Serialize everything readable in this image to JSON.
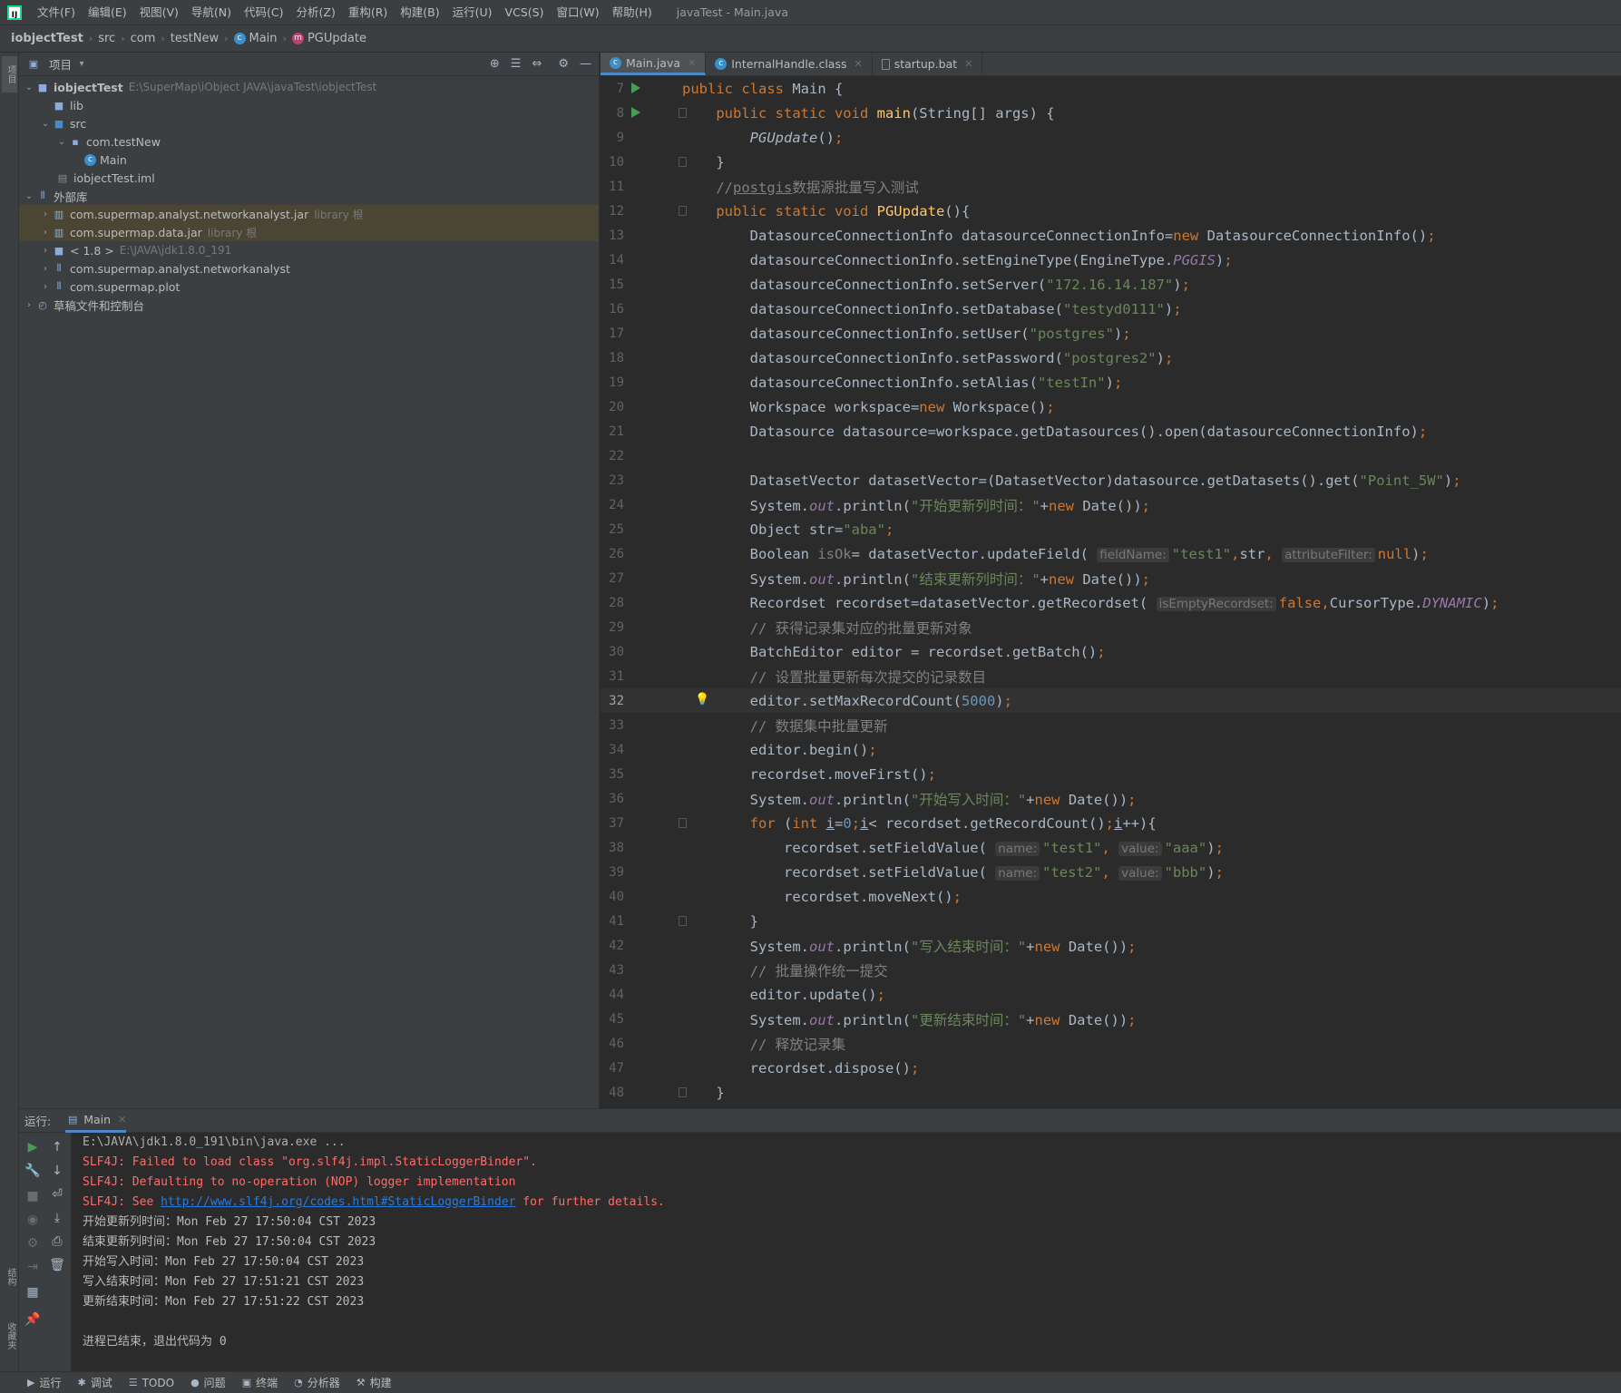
{
  "menu": {
    "items": [
      "文件(F)",
      "编辑(E)",
      "视图(V)",
      "导航(N)",
      "代码(C)",
      "分析(Z)",
      "重构(R)",
      "构建(B)",
      "运行(U)",
      "VCS(S)",
      "窗口(W)",
      "帮助(H)"
    ],
    "window_title": "javaTest - Main.java"
  },
  "breadcrumb": [
    "iobjectTest",
    "src",
    "com",
    "testNew",
    "Main",
    "PGUpdate"
  ],
  "project": {
    "title": "项目",
    "tree": [
      {
        "label": "iobjectTest",
        "hint": "E:\\SuperMap\\iObject JAVA\\javaTest\\iobjectTest"
      },
      {
        "label": "lib",
        "hint": ""
      },
      {
        "label": "src",
        "hint": ""
      },
      {
        "label": "com.testNew",
        "hint": ""
      },
      {
        "label": "Main",
        "hint": ""
      },
      {
        "label": "iobjectTest.iml",
        "hint": ""
      },
      {
        "label": "外部库",
        "hint": ""
      },
      {
        "label": "com.supermap.analyst.networkanalyst.jar",
        "hint": "library 根"
      },
      {
        "label": "com.supermap.data.jar",
        "hint": "library 根"
      },
      {
        "label": "< 1.8 >",
        "hint": "E:\\JAVA\\jdk1.8.0_191"
      },
      {
        "label": "com.supermap.analyst.networkanalyst",
        "hint": ""
      },
      {
        "label": "com.supermap.plot",
        "hint": ""
      },
      {
        "label": "草稿文件和控制台",
        "hint": ""
      }
    ]
  },
  "tabs": [
    "Main.java",
    "InternalHandle.class",
    "startup.bat"
  ],
  "code": {
    "line_numbers": [
      "7",
      "8",
      "9",
      "10",
      "11",
      "12",
      "13",
      "14",
      "15",
      "16",
      "17",
      "18",
      "19",
      "20",
      "21",
      "22",
      "23",
      "24",
      "25",
      "26",
      "27",
      "28",
      "29",
      "30",
      "31",
      "32",
      "33",
      "34",
      "35",
      "36",
      "37",
      "38",
      "39",
      "40",
      "41",
      "42",
      "43",
      "44",
      "45",
      "46",
      "47",
      "48"
    ],
    "current_line": "32",
    "literals": {
      "class_name": "Main",
      "server": "\"172.16.14.187\"",
      "database": "\"testyd0111\"",
      "user": "\"postgres\"",
      "password": "\"postgres2\"",
      "alias": "\"testIn\"",
      "dataset": "\"Point_5W\"",
      "msg_start_update": "\"开始更新列时间：\"",
      "str_value": "\"aba\"",
      "field_test1": "\"test1\"",
      "msg_end_update": "\"结束更新列时间：\"",
      "comment_get_batch": "// 获得记录集对应的批量更新对象",
      "comment_max_count": "// 设置批量更新每次提交的记录数目",
      "max_count": "5000",
      "comment_batch_update": "// 数据集中批量更新",
      "msg_start_write": "\"开始写入时间：\"",
      "val_aaa": "\"aaa\"",
      "field_test2": "\"test2\"",
      "val_bbb": "\"bbb\"",
      "msg_end_write": "\"写入结束时间：\"",
      "comment_commit": "// 批量操作统一提交",
      "msg_update_done": "\"更新结束时间：\"",
      "comment_release": "// 释放记录集",
      "comment_postgis_a": "postgis",
      "comment_postgis_b": "数据源批量写入测试"
    }
  },
  "run": {
    "label": "运行:",
    "tab": "Main",
    "console": [
      {
        "text": "E:\\JAVA\\jdk1.8.0_191\\bin\\java.exe ...",
        "kind": "cmd"
      },
      {
        "text": "SLF4J: Failed to load class \"org.slf4j.impl.StaticLoggerBinder\".",
        "kind": "err"
      },
      {
        "text": "SLF4J: Defaulting to no-operation (NOP) logger implementation",
        "kind": "err"
      },
      {
        "text": "SLF4J: See ",
        "link": "http://www.slf4j.org/codes.html#StaticLoggerBinder",
        "after": " for further details.",
        "kind": "err"
      },
      {
        "text": "开始更新列时间：Mon Feb 27 17:50:04 CST 2023",
        "kind": "out"
      },
      {
        "text": "结束更新列时间：Mon Feb 27 17:50:04 CST 2023",
        "kind": "out"
      },
      {
        "text": "开始写入时间：Mon Feb 27 17:50:04 CST 2023",
        "kind": "out"
      },
      {
        "text": "写入结束时间：Mon Feb 27 17:51:21 CST 2023",
        "kind": "out"
      },
      {
        "text": "更新结束时间：Mon Feb 27 17:51:22 CST 2023",
        "kind": "out"
      },
      {
        "text": "",
        "kind": "out"
      },
      {
        "text": "进程已结束，退出代码为 0",
        "kind": "out"
      }
    ]
  },
  "bottom_bar": [
    "运行",
    "调试",
    "TODO",
    "问题",
    "终端",
    "分析器",
    "构建"
  ],
  "side_labels": {
    "project": "项目",
    "structure": "结构",
    "favorites": "收藏夹"
  }
}
